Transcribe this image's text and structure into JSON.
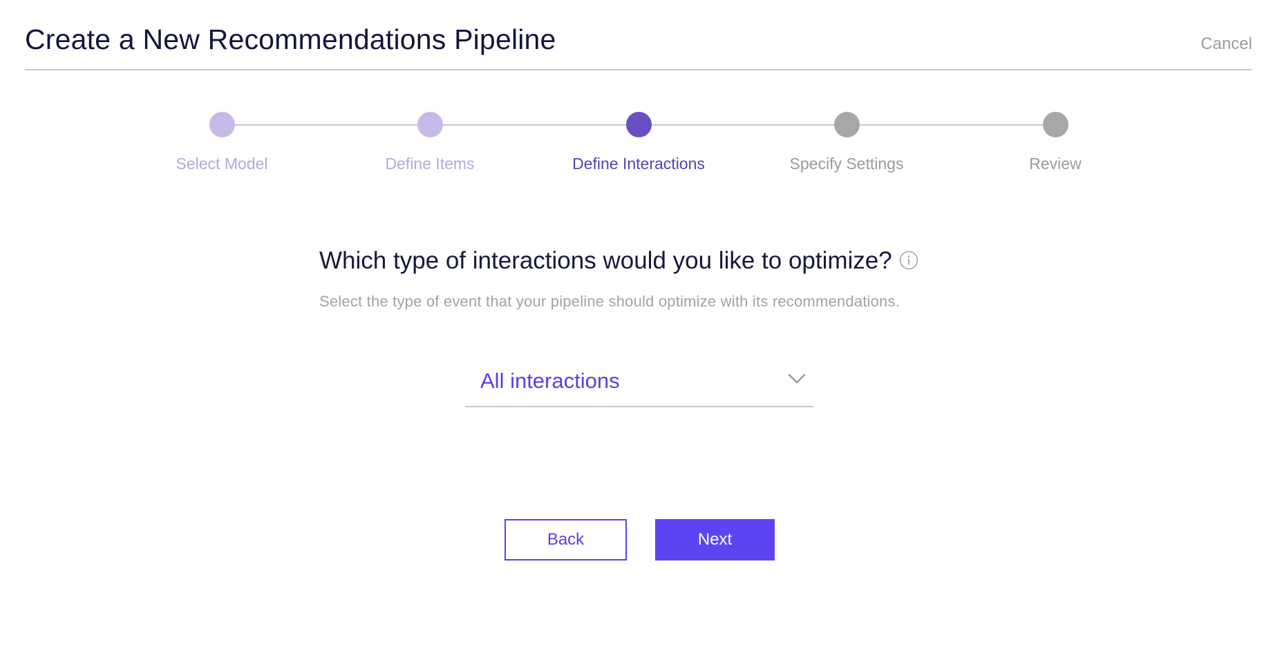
{
  "header": {
    "title": "Create a New Recommendations Pipeline",
    "cancel_label": "Cancel"
  },
  "stepper": {
    "steps": [
      {
        "label": "Select Model",
        "state": "completed"
      },
      {
        "label": "Define Items",
        "state": "completed"
      },
      {
        "label": "Define Interactions",
        "state": "current"
      },
      {
        "label": "Specify Settings",
        "state": "upcoming"
      },
      {
        "label": "Review",
        "state": "upcoming"
      }
    ]
  },
  "main": {
    "question": "Which type of interactions would you like to optimize?",
    "subtitle": "Select the type of event that your pipeline should optimize with its recommendations.",
    "info_icon": "info-circle-icon",
    "interaction_select": {
      "value": "All interactions",
      "icon": "chevron-down-icon"
    }
  },
  "actions": {
    "back_label": "Back",
    "next_label": "Next"
  },
  "colors": {
    "accent": "#5d44f3",
    "current_step": "#6a4fc4",
    "completed_step": "#c7b9e7",
    "upcoming_step": "#a7a7a7",
    "title_text": "#14143c",
    "muted_text": "#9b9ba1"
  }
}
